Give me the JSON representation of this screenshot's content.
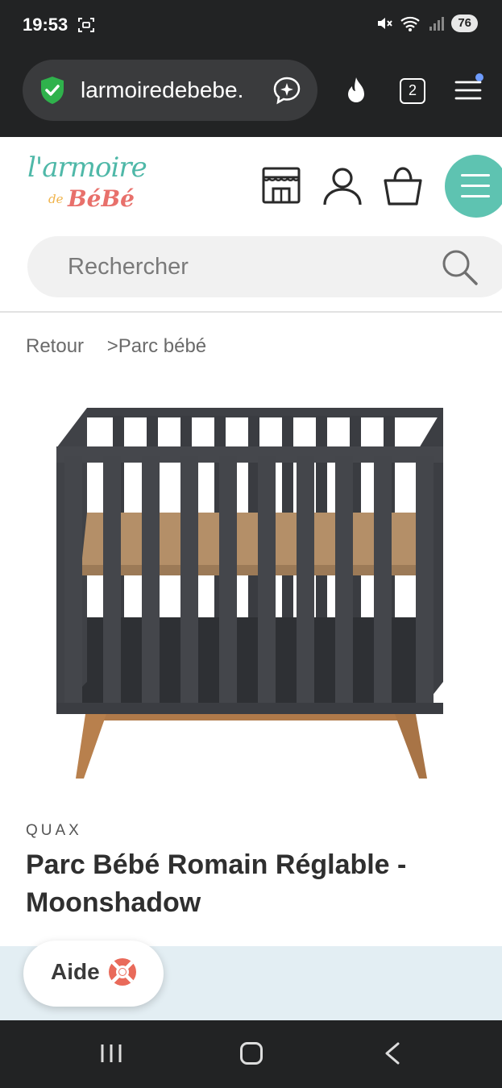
{
  "status_bar": {
    "time": "19:53",
    "battery": "76",
    "icons": [
      "screenshot-icon",
      "mute-icon",
      "wifi-icon",
      "signal-icon",
      "battery-icon"
    ]
  },
  "browser": {
    "url": "larmoiredebebe.",
    "tabs_count": "2",
    "icons": [
      "shield-icon",
      "assistant-icon",
      "fire-icon",
      "tabs-icon",
      "menu-icon"
    ]
  },
  "site": {
    "logo_line1": "l'armoire",
    "logo_de": "de",
    "logo_line2": "BéBé",
    "brand_colors": {
      "teal": "#5ec3b1",
      "coral": "#e8706b",
      "yellow": "#f0b34a"
    },
    "header_icons": [
      "store-icon",
      "user-icon",
      "cart-icon",
      "burger-menu-icon"
    ]
  },
  "search": {
    "placeholder": "Rechercher"
  },
  "breadcrumb": {
    "back": "Retour",
    "current": ">Parc bébé"
  },
  "product": {
    "brand": "QUAX",
    "title": "Parc Bébé Romain Réglable - Moonshadow"
  },
  "help": {
    "label": "Aide"
  },
  "nav": {
    "icons": [
      "recent-apps-icon",
      "home-icon",
      "back-icon"
    ]
  }
}
